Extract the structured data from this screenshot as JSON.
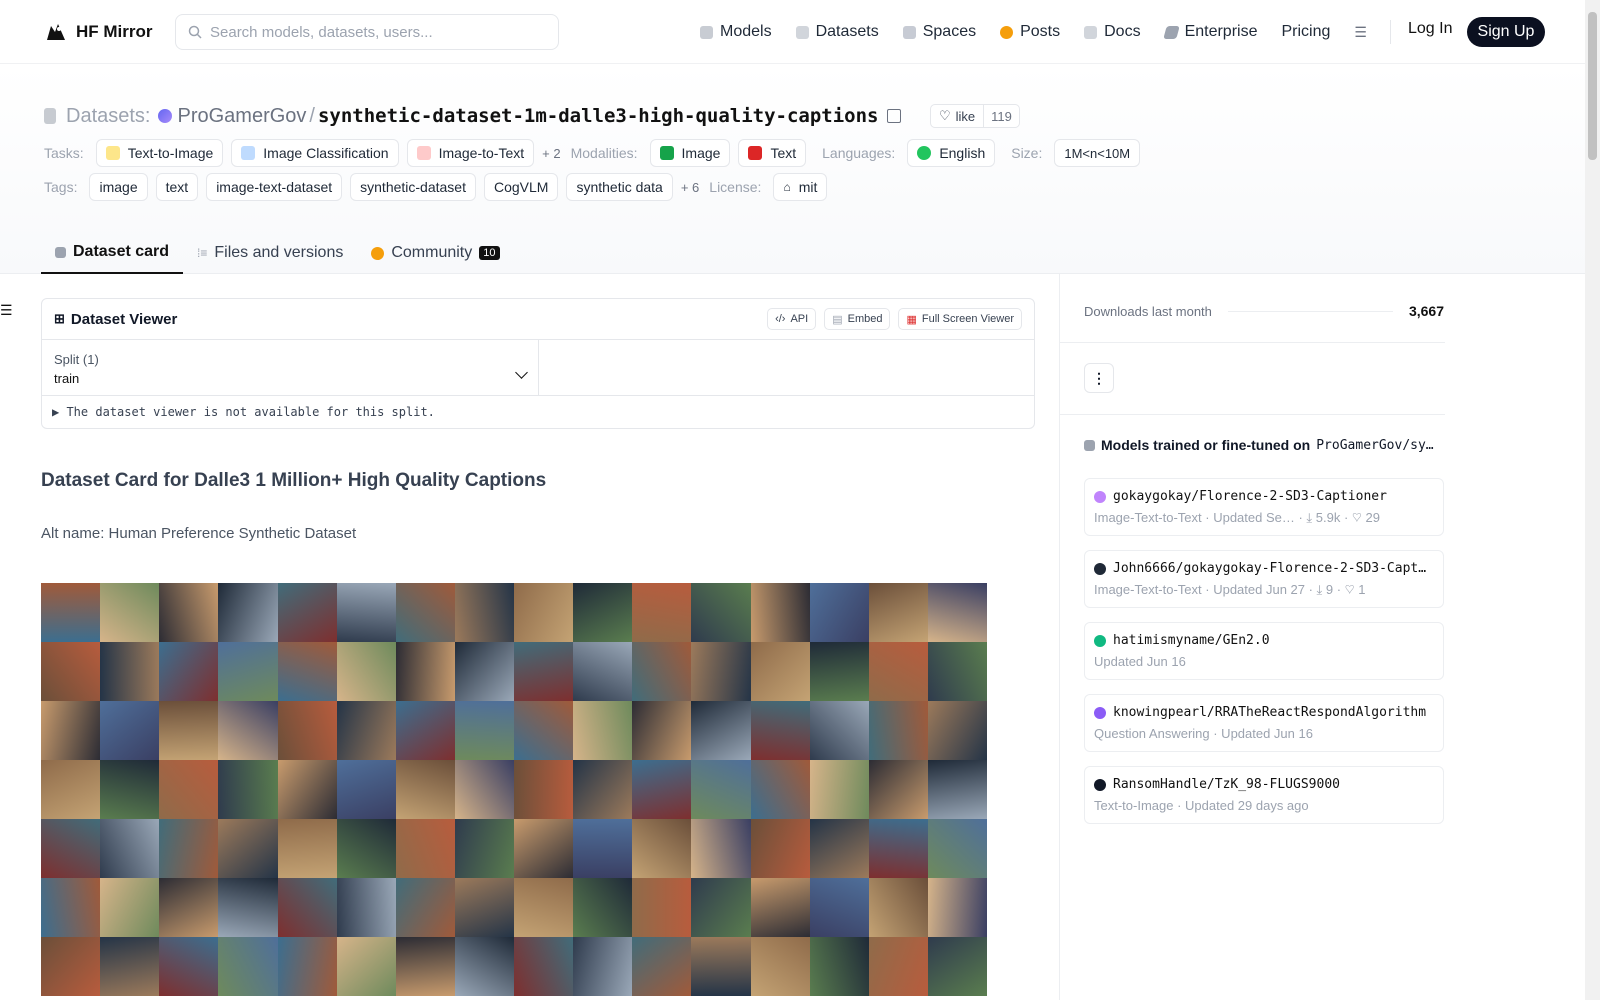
{
  "nav": {
    "brand": "HF Mirror",
    "search_placeholder": "Search models, datasets, users...",
    "links": [
      "Models",
      "Datasets",
      "Spaces",
      "Posts",
      "Docs",
      "Enterprise",
      "Pricing"
    ],
    "login": "Log In",
    "signup": "Sign Up"
  },
  "header": {
    "section_label": "Datasets:",
    "owner": "ProGamerGov",
    "slash": "/",
    "repo_name": "synthetic-dataset-1m-dalle3-high-quality-captions",
    "like_label": "like",
    "like_count": "119",
    "tasks_label": "Tasks:",
    "tasks": [
      "Text-to-Image",
      "Image Classification",
      "Image-to-Text"
    ],
    "tasks_more": "+ 2",
    "modalities_label": "Modalities:",
    "modalities": [
      "Image",
      "Text"
    ],
    "languages_label": "Languages:",
    "language": "English",
    "size_label": "Size:",
    "size": "1M<n<10M",
    "tags_label": "Tags:",
    "tags": [
      "image",
      "text",
      "image-text-dataset",
      "synthetic-dataset",
      "CogVLM",
      "synthetic data"
    ],
    "tags_more": "+ 6",
    "license_label": "License:",
    "license": "mit"
  },
  "tabs": {
    "dataset_card": "Dataset card",
    "files": "Files and versions",
    "community": "Community",
    "community_count": "10"
  },
  "viewer": {
    "title": "Dataset Viewer",
    "api": "API",
    "embed": "Embed",
    "fullscreen": "Full Screen Viewer",
    "split_label": "Split (1)",
    "split_value": "train",
    "not_available": "The dataset viewer is not available for this split."
  },
  "card": {
    "title": "Dataset Card for Dalle3 1 Million+ High Quality Captions",
    "alt_name": "Alt name: Human Preference Synthetic Dataset"
  },
  "sidebar": {
    "downloads_label": "Downloads last month",
    "downloads_value": "3,667",
    "kebab": "⋮",
    "models_title": "Models trained or fine-tuned on",
    "models_title_repo": "ProGamerGov/sy…",
    "models": [
      {
        "name": "gokaygokay/Florence-2-SD3-Captioner",
        "meta": "Image-Text-to-Text · Updated Se… · ⤓ 5.9k · ♡ 29",
        "color": "#c084fc"
      },
      {
        "name": "John6666/gokaygokay-Florence-2-SD3-Capt…",
        "meta": "Image-Text-to-Text · Updated Jun 27 · ⤓ 9 · ♡ 1",
        "color": "#1f2937"
      },
      {
        "name": "hatimismyname/GEn2.0",
        "meta": "Updated Jun 16",
        "color": "#10b981"
      },
      {
        "name": "knowingpearl/RRATheReactRespondAlgorithm",
        "meta": "Question Answering · Updated Jun 16",
        "color": "#8b5cf6"
      },
      {
        "name": "RansomHandle/TzK_98-FLUGS9000",
        "meta": "Text-to-Image · Updated 29 days ago",
        "color": "#111827"
      }
    ]
  }
}
